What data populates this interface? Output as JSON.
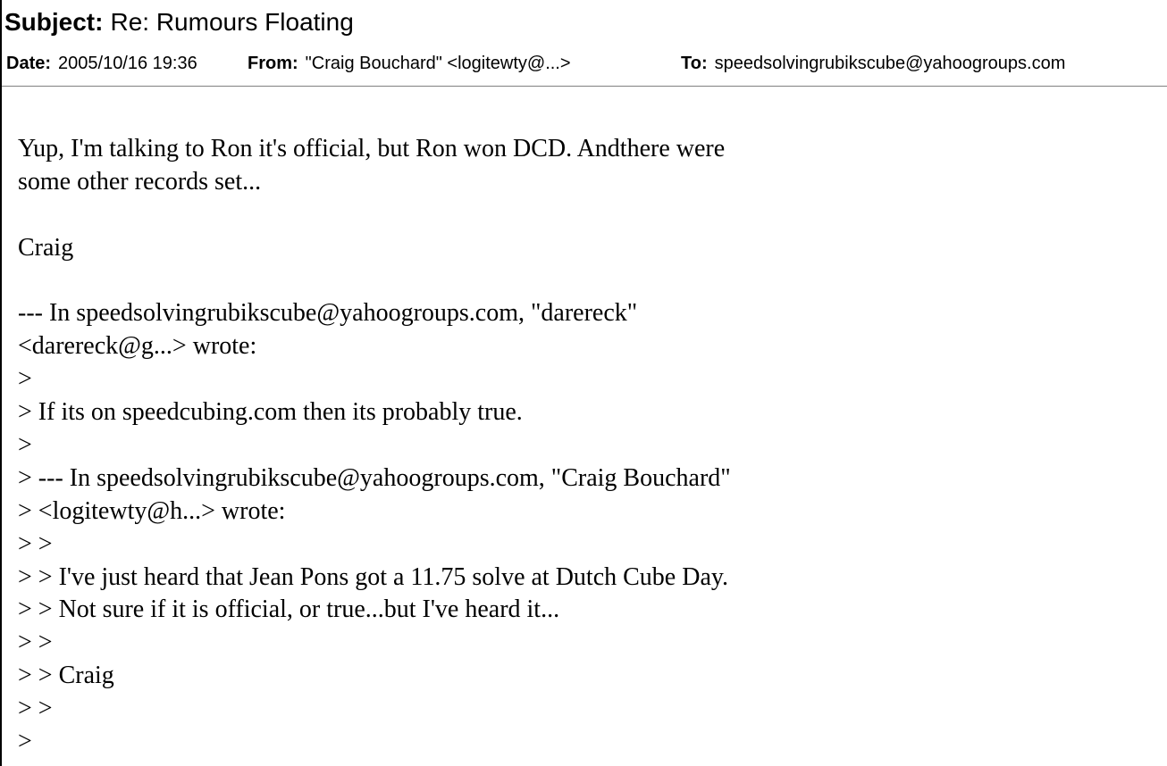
{
  "header": {
    "subject_label": "Subject:",
    "subject": "Re: Rumours Floating",
    "date_label": "Date:",
    "date": "2005/10/16 19:36",
    "from_label": "From:",
    "from": "\"Craig Bouchard\" <logitewty@...>",
    "to_label": "To:",
    "to": "speedsolvingrubikscube@yahoogroups.com"
  },
  "body": {
    "lines": [
      "Yup, I'm talking to Ron it's official, but Ron won DCD. Andthere were",
      "some other records set...",
      "",
      "Craig",
      "",
      "--- In speedsolvingrubikscube@yahoogroups.com, \"darereck\"",
      "<darereck@g...> wrote:",
      ">",
      "> If its on speedcubing.com then its probably true.",
      ">",
      "> --- In speedsolvingrubikscube@yahoogroups.com, \"Craig Bouchard\"",
      "> <logitewty@h...> wrote:",
      "> >",
      "> > I've just heard that Jean Pons got a 11.75 solve at Dutch Cube Day.",
      "> > Not sure if it is official, or true...but I've heard it...",
      "> >",
      "> > Craig",
      "> >",
      ">"
    ]
  }
}
